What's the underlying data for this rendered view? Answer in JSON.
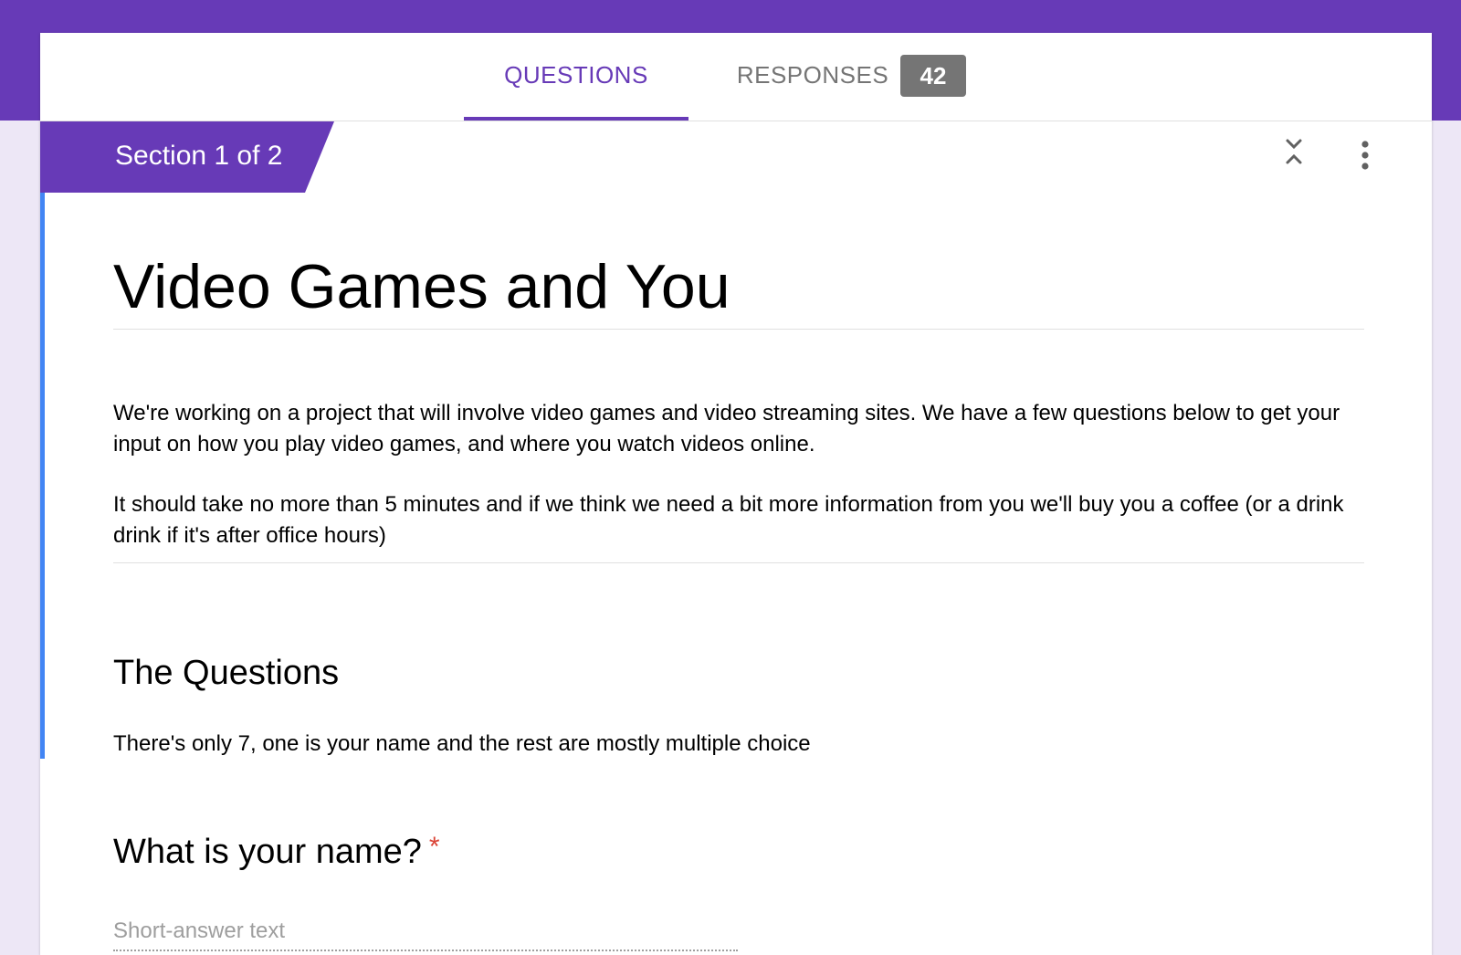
{
  "tabs": {
    "questions_label": "QUESTIONS",
    "responses_label": "RESPONSES",
    "responses_count": "42"
  },
  "section": {
    "label": "Section 1 of 2"
  },
  "form": {
    "title": "Video Games and You",
    "description": [
      "We're working on a project that will involve video games and video streaming sites. We have a few questions below to get your input on how you play video games, and where you watch videos online.",
      "It should take no more than 5 minutes and if we think we need a bit more information from you we'll buy you a coffee (or a drink drink if it's after office hours)"
    ]
  },
  "section_header": {
    "title": "The Questions",
    "description": "There's only 7, one is your name and the rest are mostly multiple choice"
  },
  "question": {
    "title": "What is your name?",
    "required_marker": "*",
    "placeholder": "Short-answer text"
  },
  "icons": {
    "collapse": "collapse-section-icon",
    "more": "more-vert-icon"
  },
  "colors": {
    "primary": "#673ab7",
    "background": "#ede7f6",
    "accent_bar": "#4285f4",
    "badge": "#757575",
    "required": "#db4437"
  }
}
